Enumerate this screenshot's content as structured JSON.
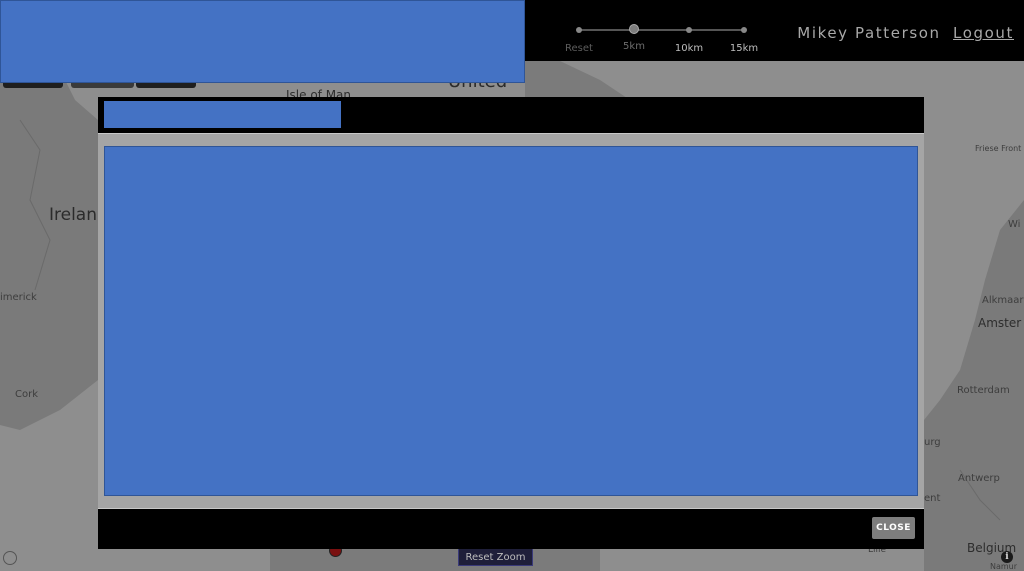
{
  "map": {
    "labels": {
      "isle_of_man": "Isle of Man",
      "united": "United",
      "ireland": "Irelan",
      "limerick": "imerick",
      "cork": "Cork",
      "friese_front": "Friese Front",
      "alkmaar": "Alkmaar",
      "amsterdam": "Amster",
      "rotterdam": "Rotterdam",
      "urg": "urg",
      "antwerp": "Antwerp",
      "ent": "ent",
      "belgium": "Belgium",
      "lille": "Lille",
      "namur": "Namur",
      "wi": "Wi"
    },
    "reset_zoom_label": "Reset Zoom",
    "info_icon": "i"
  },
  "header": {
    "user_name": "Mikey Patterson",
    "logout_label": "Logout"
  },
  "radius_slider": {
    "stops": [
      "Reset",
      "5km",
      "10km",
      "15km"
    ],
    "selected": "5km"
  },
  "modal": {
    "close_label": "CLOSE"
  },
  "colors": {
    "redaction": "#4472c4",
    "topbar": "#000000",
    "map": "#8b8b8b"
  }
}
